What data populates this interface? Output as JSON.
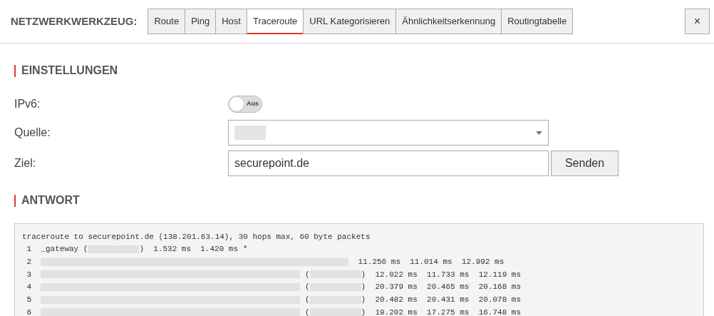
{
  "toolbar": {
    "title": "NETZWERKWERKZEUG:",
    "tabs": [
      {
        "label": "Route",
        "selected": false
      },
      {
        "label": "Ping",
        "selected": false
      },
      {
        "label": "Host",
        "selected": false
      },
      {
        "label": "Traceroute",
        "selected": true
      },
      {
        "label": "URL Kategorisieren",
        "selected": false
      },
      {
        "label": "Ähnlichkeitserkennung",
        "selected": false
      },
      {
        "label": "Routingtabelle",
        "selected": false
      }
    ],
    "close": "×"
  },
  "settings": {
    "heading": "EINSTELLUNGEN",
    "ipv6": {
      "label": "IPv6:",
      "on": false,
      "state_text": "Aus"
    },
    "source": {
      "label": "Quelle:",
      "redacted": true
    },
    "target": {
      "label": "Ziel:",
      "value": "securepoint.de"
    },
    "send": "Senden"
  },
  "response": {
    "heading": "ANTWORT",
    "lines": [
      {
        "parts": [
          {
            "kind": "text",
            "text": "traceroute to securepoint.de (138.201.63.14), 30 hops max, 60 byte packets"
          }
        ]
      },
      {
        "parts": [
          {
            "kind": "text",
            "text": " 1  _gateway ("
          },
          {
            "kind": "redacted-short"
          },
          {
            "kind": "text",
            "text": ")  1.532 ms  1.420 ms *"
          }
        ]
      },
      {
        "parts": [
          {
            "kind": "text",
            "text": " 2  "
          },
          {
            "kind": "redacted-long"
          },
          {
            "kind": "text",
            "text": "  11.256 ms  11.014 ms  12.992 ms"
          }
        ]
      },
      {
        "parts": [
          {
            "kind": "text",
            "text": " 3  "
          },
          {
            "kind": "redacted-mid"
          },
          {
            "kind": "text",
            "text": " ("
          },
          {
            "kind": "redacted-short"
          },
          {
            "kind": "text",
            "text": ")  12.022 ms  11.733 ms  12.119 ms"
          }
        ]
      },
      {
        "parts": [
          {
            "kind": "text",
            "text": " 4  "
          },
          {
            "kind": "redacted-mid"
          },
          {
            "kind": "text",
            "text": " ("
          },
          {
            "kind": "redacted-short"
          },
          {
            "kind": "text",
            "text": ")  20.379 ms  20.465 ms  20.168 ms"
          }
        ]
      },
      {
        "parts": [
          {
            "kind": "text",
            "text": " 5  "
          },
          {
            "kind": "redacted-mid"
          },
          {
            "kind": "text",
            "text": " ("
          },
          {
            "kind": "redacted-short"
          },
          {
            "kind": "text",
            "text": ")  20.482 ms  20.431 ms  20.078 ms"
          }
        ]
      },
      {
        "parts": [
          {
            "kind": "text",
            "text": " 6  "
          },
          {
            "kind": "redacted-mid"
          },
          {
            "kind": "text",
            "text": " ("
          },
          {
            "kind": "redacted-short"
          },
          {
            "kind": "text",
            "text": ")  19.202 ms  17.275 ms  16.748 ms"
          }
        ]
      }
    ]
  }
}
